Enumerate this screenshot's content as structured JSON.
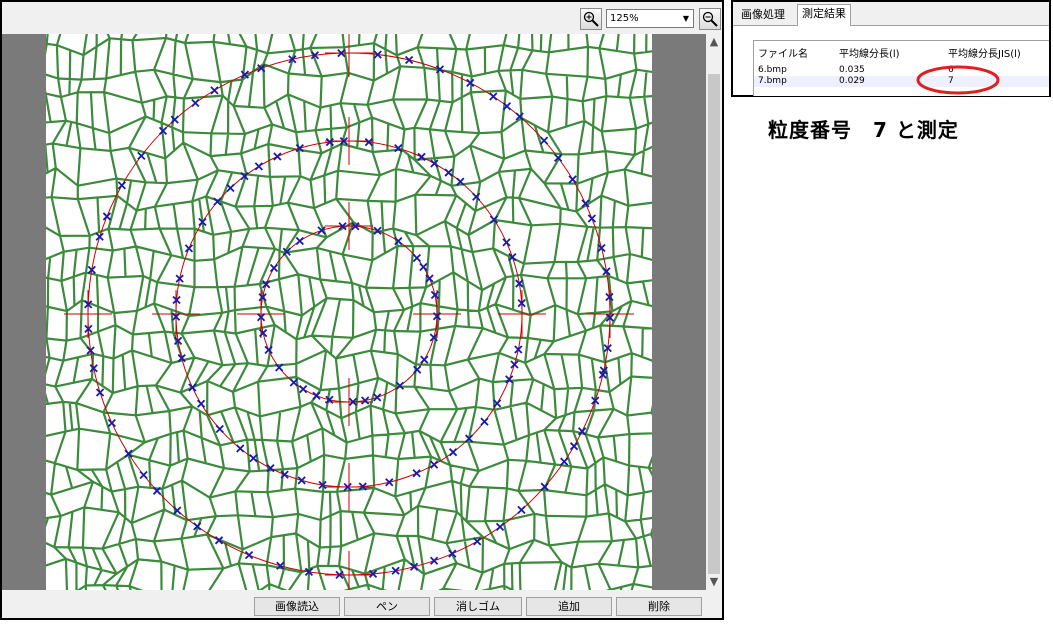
{
  "toolbar": {
    "zoom_value": "125%",
    "zoom_in_icon": "zoom-in-icon",
    "zoom_out_icon": "zoom-out-icon"
  },
  "bottom_buttons": [
    "画像読込",
    "ペン",
    "消しゴム",
    "追加",
    "削除"
  ],
  "result_panel": {
    "tabs": [
      "画像処理",
      "測定結果"
    ],
    "active_tab": "測定結果",
    "columns": [
      "ファイル名",
      "平均線分長(l)",
      "平均線分長JIS(l)"
    ],
    "rows": [
      {
        "file": "6.bmp",
        "mean": "0.035",
        "jis": "6"
      },
      {
        "file": "7.bmp",
        "mean": "0.029",
        "jis": "7"
      }
    ]
  },
  "annotation": "粒度番号　7 と測定",
  "colors": {
    "grain_boundary": "#3c8a3c",
    "circle": "#cc0000",
    "marker": "#1a1aaa",
    "highlight": "#e02020"
  }
}
